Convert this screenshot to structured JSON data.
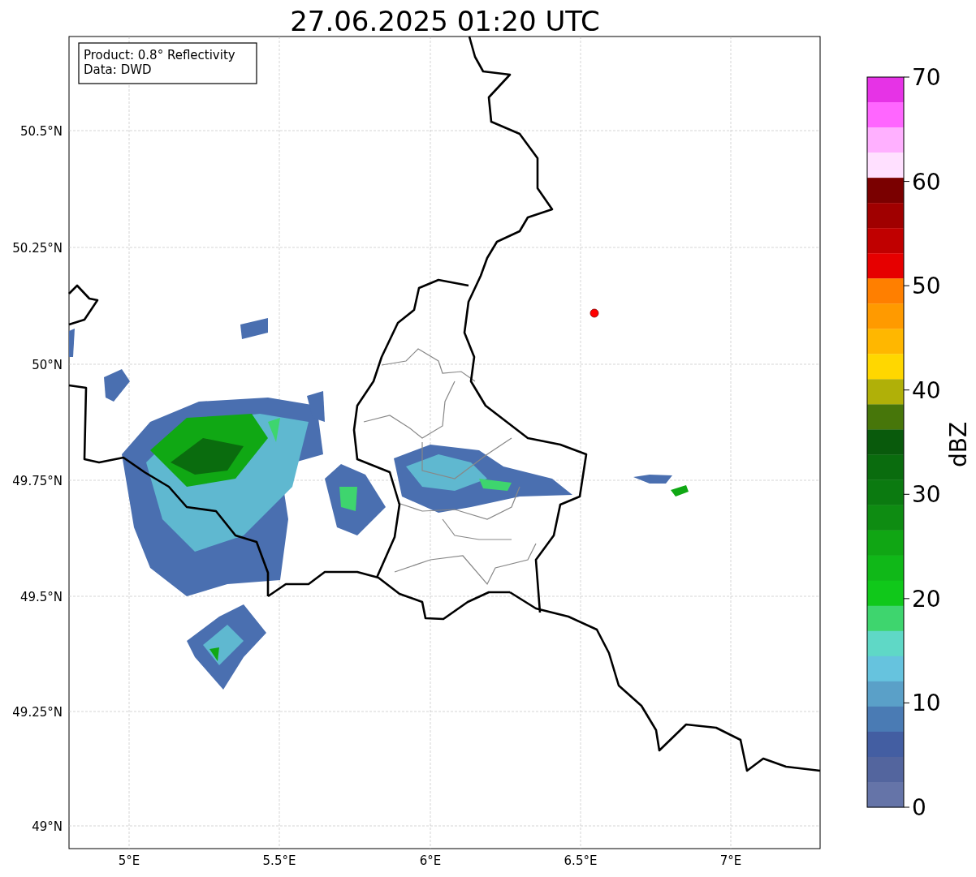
{
  "title": "27.06.2025 01:20 UTC",
  "info_box": {
    "lines": [
      "Product: 0.8° Reflectivity",
      "Data: DWD"
    ]
  },
  "y_ticks": [
    "50.5°N",
    "50.25°N",
    "50°N",
    "49.75°N",
    "49.5°N",
    "49.25°N",
    "49°N"
  ],
  "x_ticks": [
    "5°E",
    "5.5°E",
    "6°E",
    "6.5°E",
    "7°E"
  ],
  "colorbar": {
    "label": "dBZ",
    "ticks": [
      "70",
      "60",
      "50",
      "40",
      "30",
      "20",
      "10",
      "0"
    ],
    "segments": [
      {
        "color": "#e633e6"
      },
      {
        "color": "#ff66ff"
      },
      {
        "color": "#ffb0ff"
      },
      {
        "color": "#ffe0ff"
      },
      {
        "color": "#7a0000"
      },
      {
        "color": "#a00000"
      },
      {
        "color": "#c00000"
      },
      {
        "color": "#e60000"
      },
      {
        "color": "#ff7f00"
      },
      {
        "color": "#ff9a00"
      },
      {
        "color": "#ffb700"
      },
      {
        "color": "#ffd700"
      },
      {
        "color": "#b0b008"
      },
      {
        "color": "#47760a"
      },
      {
        "color": "#095a0c"
      },
      {
        "color": "#0a6c0e"
      },
      {
        "color": "#0b7a10"
      },
      {
        "color": "#0e8c12"
      },
      {
        "color": "#10a614"
      },
      {
        "color": "#10b818"
      },
      {
        "color": "#10c81a"
      },
      {
        "color": "#3ed56e"
      },
      {
        "color": "#5fd8c6"
      },
      {
        "color": "#66c3de"
      },
      {
        "color": "#5aa0c8"
      },
      {
        "color": "#4a7bb4"
      },
      {
        "color": "#435ea2"
      },
      {
        "color": "#53659e"
      },
      {
        "color": "#6574a8"
      }
    ]
  }
}
